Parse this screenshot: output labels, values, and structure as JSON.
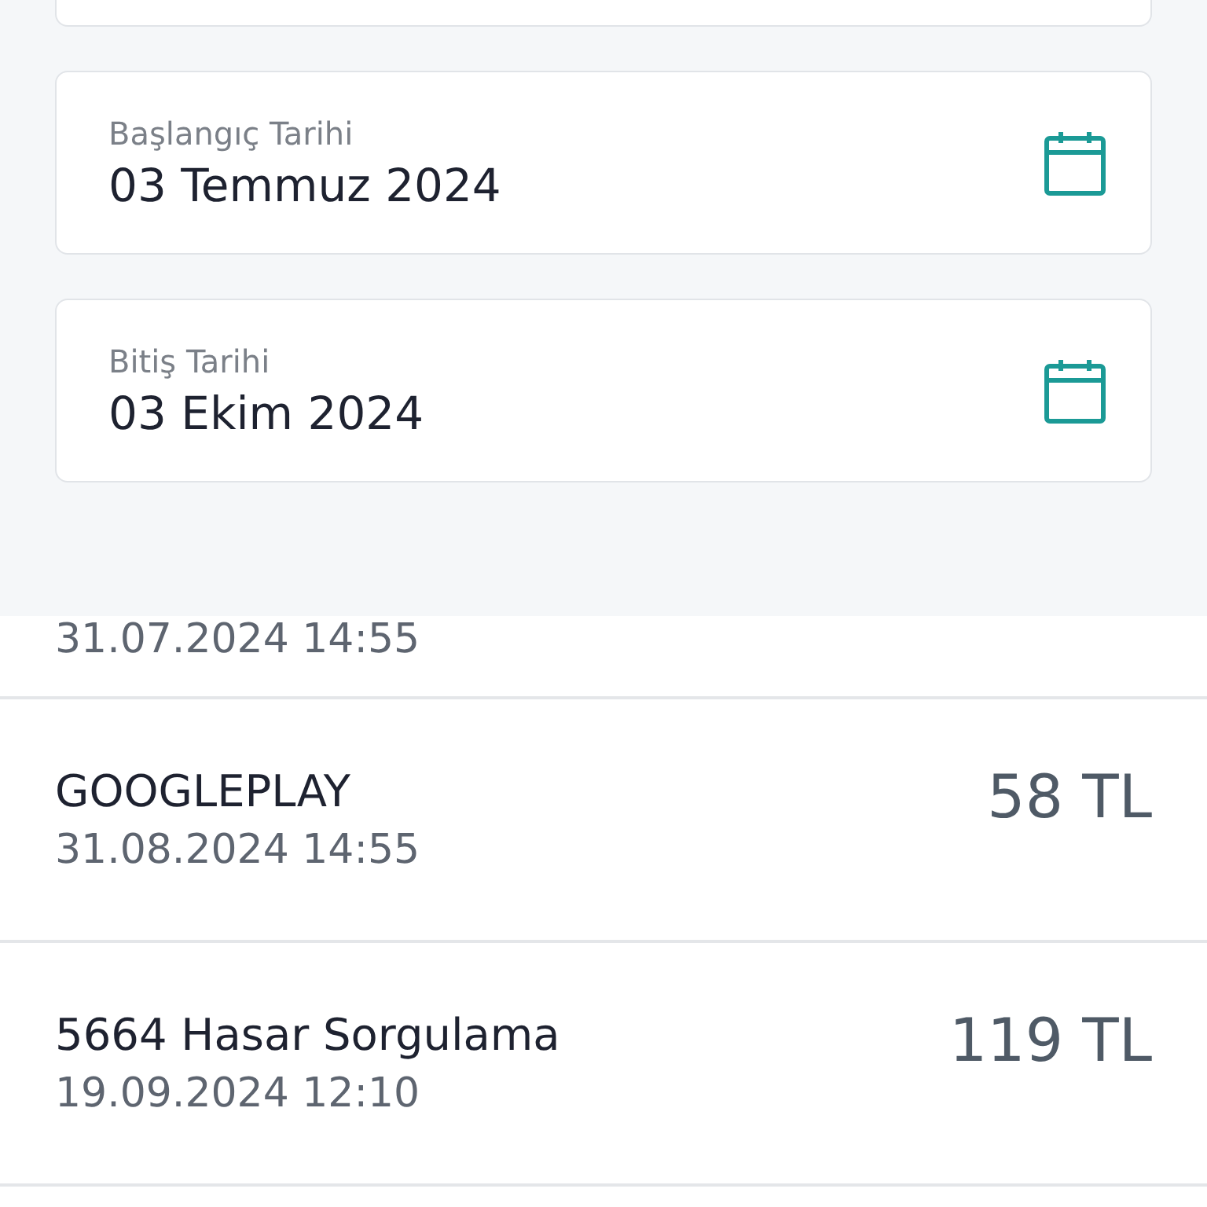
{
  "date_fields": [
    {
      "label": "Başlangıç Tarihi",
      "value": "03 Temmuz 2024"
    },
    {
      "label": "Bitiş Tarihi",
      "value": "03 Ekim 2024"
    }
  ],
  "transactions": [
    {
      "date": "31.07.2024 14:55"
    },
    {
      "name": "GOOGLEPLAY",
      "date": "31.08.2024 14:55",
      "amount": "58 TL"
    },
    {
      "name": "5664 Hasar Sorgulama",
      "date": "19.09.2024 12:10",
      "amount": "119 TL"
    }
  ]
}
